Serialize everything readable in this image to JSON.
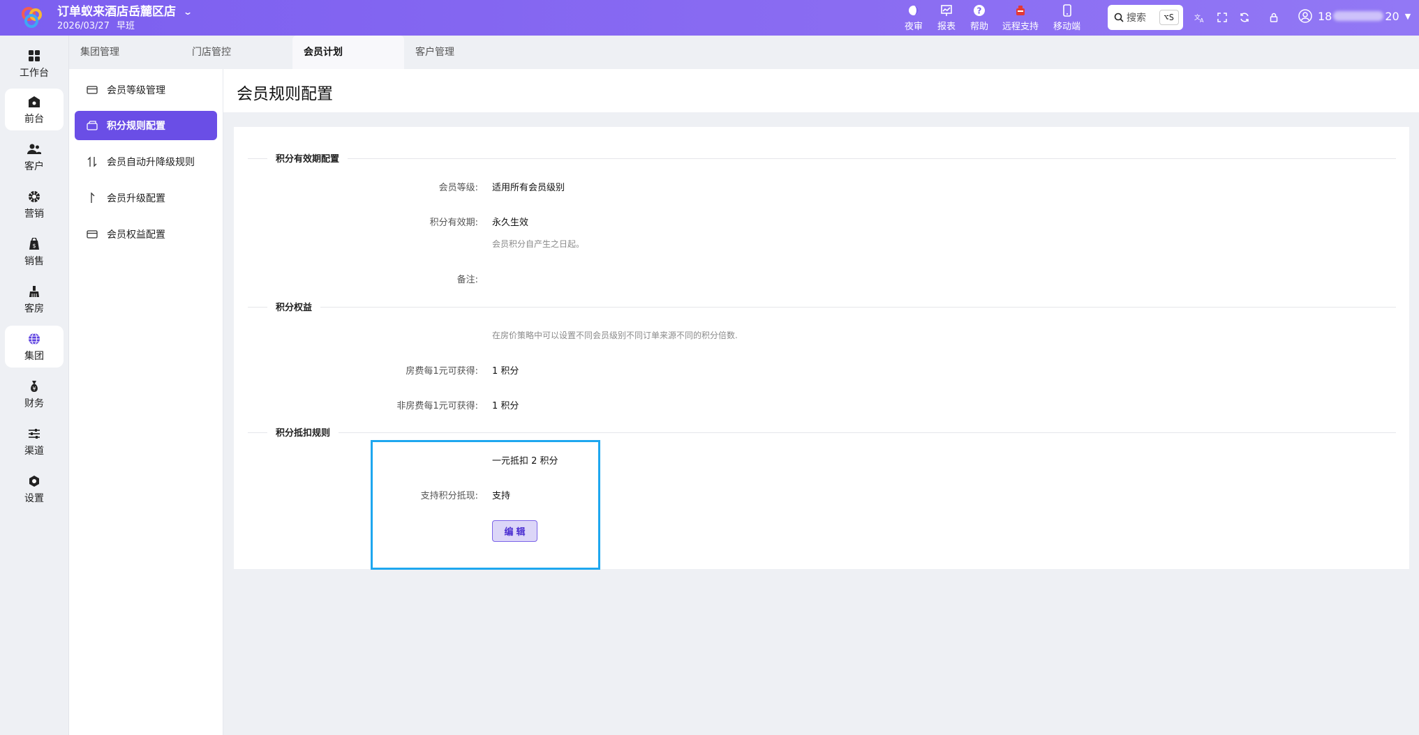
{
  "header": {
    "store_name": "订单蚁来酒店岳麓区店",
    "date": "2026/03/27",
    "shift": "早班",
    "tools": [
      {
        "label": "夜审",
        "icon": "moon-icon"
      },
      {
        "label": "报表",
        "icon": "chart-icon"
      },
      {
        "label": "帮助",
        "icon": "help-icon"
      },
      {
        "label": "远程支持",
        "icon": "remote-support-icon"
      },
      {
        "label": "移动端",
        "icon": "mobile-icon"
      }
    ],
    "search_label": "搜索",
    "search_shortcut": "⌥S",
    "user_prefix": "18",
    "user_suffix": "20"
  },
  "leftnav": [
    {
      "label": "工作台",
      "icon": "dashboard-icon",
      "active": false
    },
    {
      "label": "前台",
      "icon": "front-desk-icon",
      "active": true
    },
    {
      "label": "客户",
      "icon": "customers-icon",
      "active": false
    },
    {
      "label": "营销",
      "icon": "marketing-icon",
      "active": false
    },
    {
      "label": "销售",
      "icon": "sales-icon",
      "active": false
    },
    {
      "label": "客房",
      "icon": "housekeeping-icon",
      "active": false
    },
    {
      "label": "集团",
      "icon": "globe-icon",
      "active": true
    },
    {
      "label": "财务",
      "icon": "finance-icon",
      "active": false
    },
    {
      "label": "渠道",
      "icon": "sliders-icon",
      "active": false
    },
    {
      "label": "设置",
      "icon": "settings-icon",
      "active": false
    }
  ],
  "tabs": [
    {
      "label": "集团管理",
      "active": false
    },
    {
      "label": "门店管控",
      "active": false
    },
    {
      "label": "会员计划",
      "active": true
    },
    {
      "label": "客户管理",
      "active": false
    }
  ],
  "subnav": [
    {
      "label": "会员等级管理",
      "icon": "card-icon",
      "active": false
    },
    {
      "label": "积分规则配置",
      "icon": "wallet-icon",
      "active": true
    },
    {
      "label": "会员自动升降级规则",
      "icon": "up-down-icon",
      "active": false
    },
    {
      "label": "会员升级配置",
      "icon": "arrow-up-icon",
      "active": false
    },
    {
      "label": "会员权益配置",
      "icon": "card-icon",
      "active": false
    }
  ],
  "page": {
    "title": "会员规则配置",
    "sections": {
      "validity": {
        "title": "积分有效期配置",
        "level_label": "会员等级:",
        "level_value": "适用所有会员级别",
        "validity_label": "积分有效期:",
        "validity_value": "永久生效",
        "validity_hint": "会员积分自产生之日起。",
        "note_label": "备注:"
      },
      "benefits": {
        "title": "积分权益",
        "hint": "在房价策略中可以设置不同会员级别不同订单来源不同的积分倍数.",
        "room_label": "房费每1元可获得:",
        "room_value": "1 积分",
        "nonroom_label": "非房费每1元可获得:",
        "nonroom_value": "1 积分"
      },
      "deduction": {
        "title": "积分抵扣规则",
        "rate_value": "一元抵扣 2 积分",
        "cash_label": "支持积分抵现:",
        "cash_value": "支持",
        "edit_label": "编辑"
      }
    }
  },
  "colors": {
    "topbar": "#7c5ff0",
    "active_subnav": "#6a4ee6",
    "highlight_border": "#1ea7ef",
    "edit_button_bg": "#dcd6f8"
  }
}
